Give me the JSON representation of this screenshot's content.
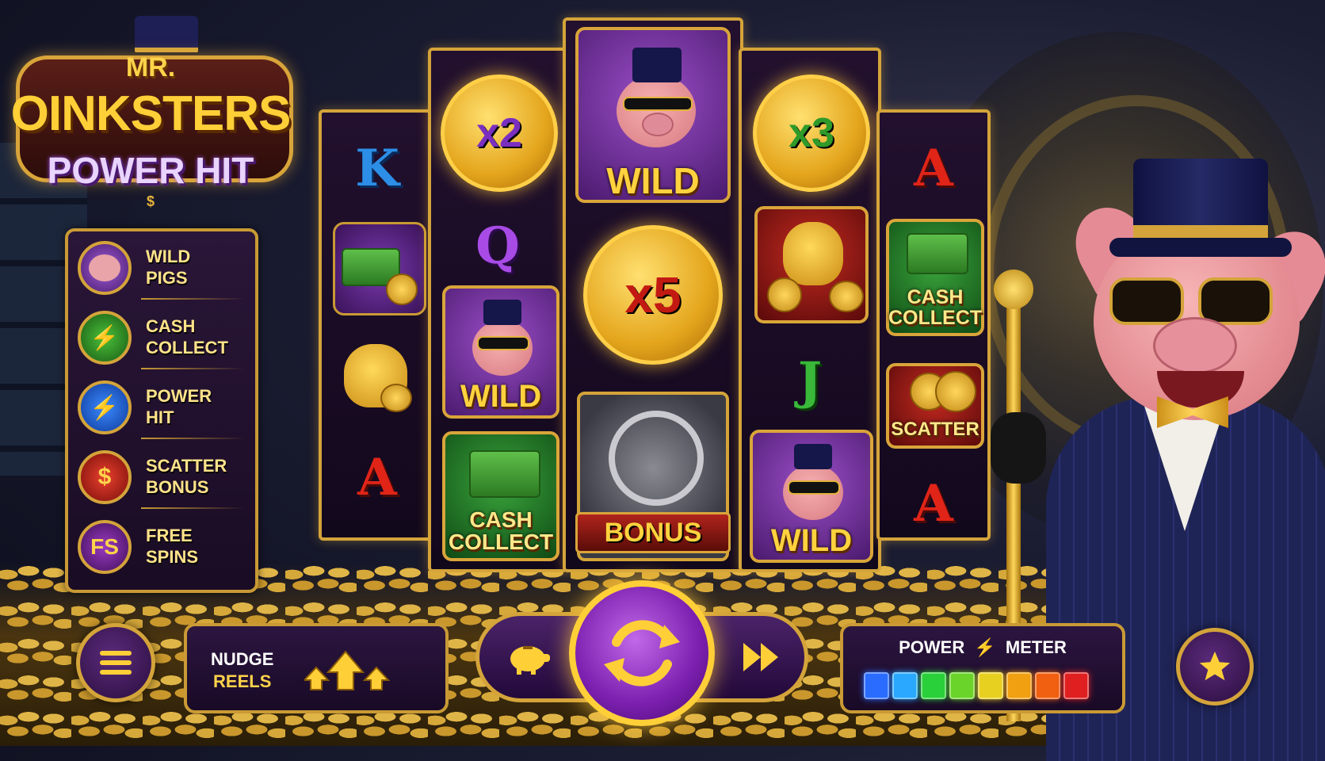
{
  "logo": {
    "line1": "MR.",
    "line2": "OINKSTERS",
    "line3": "POWER HIT",
    "mark": "$"
  },
  "legend": [
    {
      "label_line1": "WILD",
      "label_line2": "PIGS",
      "icon": "pig-icon",
      "color": "#7a3fb0",
      "glyph": ""
    },
    {
      "label_line1": "CASH",
      "label_line2": "COLLECT",
      "icon": "cash-lightning-icon",
      "color": "#2f8f2a",
      "glyph": "⚡"
    },
    {
      "label_line1": "POWER",
      "label_line2": "HIT",
      "icon": "lightning-icon",
      "color": "#1f5fc8",
      "glyph": "⚡"
    },
    {
      "label_line1": "SCATTER",
      "label_line2": "BONUS",
      "icon": "dollar-coin-icon",
      "color": "#c42a1c",
      "glyph": "$"
    },
    {
      "label_line1": "FREE",
      "label_line2": "SPINS",
      "icon": "fs-icon",
      "color": "#6a1e8c",
      "glyph": "FS"
    }
  ],
  "reels": {
    "reel1": {
      "top": "K",
      "bottom": "A",
      "top_color": "#2c8ee6",
      "bottom_color": "#e02418"
    },
    "reel2": {
      "coin": "x2",
      "coin_color": "#7a2fc0",
      "letter": "Q",
      "letter_color": "#a84be6",
      "wild": "WILD",
      "cash_line1": "CASH",
      "cash_line2": "COLLECT"
    },
    "reel3": {
      "wild": "WILD",
      "coin": "x5",
      "coin_color": "#c21a12",
      "bonus": "BONUS"
    },
    "reel4": {
      "coin": "x3",
      "coin_color": "#2f9a2a",
      "letter": "J",
      "letter_color": "#39b83a",
      "wild": "WILD"
    },
    "reel5": {
      "top": "A",
      "bottom": "A",
      "letter_color": "#e02418",
      "cash_line1": "CASH",
      "cash_line2": "COLLECT",
      "scatter": "SCATTER"
    }
  },
  "controls": {
    "nudge_line1": "NUDGE",
    "nudge_line2": "REELS",
    "power_meter_left": "POWER",
    "power_meter_right": "METER",
    "power_meter_colors": [
      "#2a6cff",
      "#2aa8ff",
      "#2ad03a",
      "#6ad42a",
      "#e8d020",
      "#f0a010",
      "#f06010",
      "#e02020"
    ]
  }
}
